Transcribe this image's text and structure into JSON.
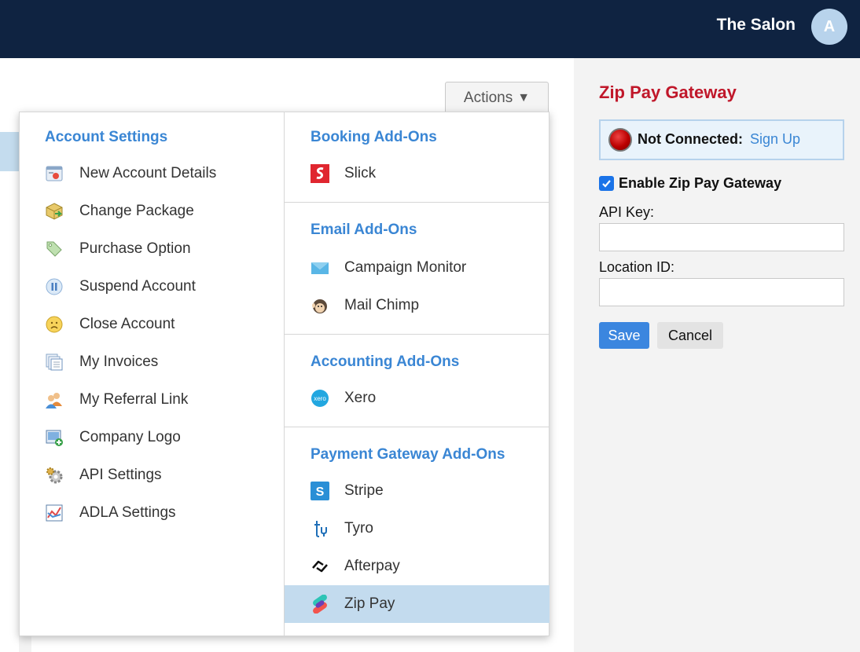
{
  "header": {
    "business_name": "The Salon",
    "avatar_initial": "A",
    "background_color": "#0f2341"
  },
  "actions": {
    "label": "Actions",
    "caret": "▼"
  },
  "menu": {
    "account_settings": {
      "title": "Account Settings",
      "items": [
        {
          "label": "New Account Details",
          "icon": "account-details-icon"
        },
        {
          "label": "Change Package",
          "icon": "package-icon"
        },
        {
          "label": "Purchase Option",
          "icon": "tag-icon"
        },
        {
          "label": "Suspend Account",
          "icon": "pause-icon"
        },
        {
          "label": "Close Account",
          "icon": "sad-face-icon"
        },
        {
          "label": "My Invoices",
          "icon": "invoices-icon"
        },
        {
          "label": "My Referral Link",
          "icon": "referral-users-icon"
        },
        {
          "label": "Company Logo",
          "icon": "image-add-icon"
        },
        {
          "label": "API Settings",
          "icon": "gear-icon"
        },
        {
          "label": "ADLA Settings",
          "icon": "chart-icon"
        }
      ]
    },
    "booking_addons": {
      "title": "Booking Add-Ons",
      "items": [
        {
          "label": "Slick",
          "icon": "slick-logo-icon"
        }
      ]
    },
    "email_addons": {
      "title": "Email Add-Ons",
      "items": [
        {
          "label": "Campaign Monitor",
          "icon": "campaign-monitor-icon"
        },
        {
          "label": "Mail Chimp",
          "icon": "mailchimp-icon"
        }
      ]
    },
    "accounting_addons": {
      "title": "Accounting Add-Ons",
      "items": [
        {
          "label": "Xero",
          "icon": "xero-icon"
        }
      ]
    },
    "payment_addons": {
      "title": "Payment Gateway Add-Ons",
      "items": [
        {
          "label": "Stripe",
          "icon": "stripe-icon"
        },
        {
          "label": "Tyro",
          "icon": "tyro-icon"
        },
        {
          "label": "Afterpay",
          "icon": "afterpay-icon"
        },
        {
          "label": "Zip Pay",
          "icon": "zip-pay-icon",
          "selected": true
        }
      ]
    }
  },
  "panel": {
    "title": "Zip Pay Gateway",
    "status_label": "Not Connected:",
    "status_link": "Sign Up",
    "enable_label": "Enable Zip Pay Gateway",
    "enable_checked": true,
    "api_key_label": "API Key:",
    "api_key_value": "",
    "location_id_label": "Location ID:",
    "location_id_value": "",
    "save_label": "Save",
    "cancel_label": "Cancel"
  },
  "colors": {
    "accent_blue": "#3a86d4",
    "title_red": "#c0172a",
    "selected_row": "#c3dbee",
    "save_button": "#3b86df"
  }
}
